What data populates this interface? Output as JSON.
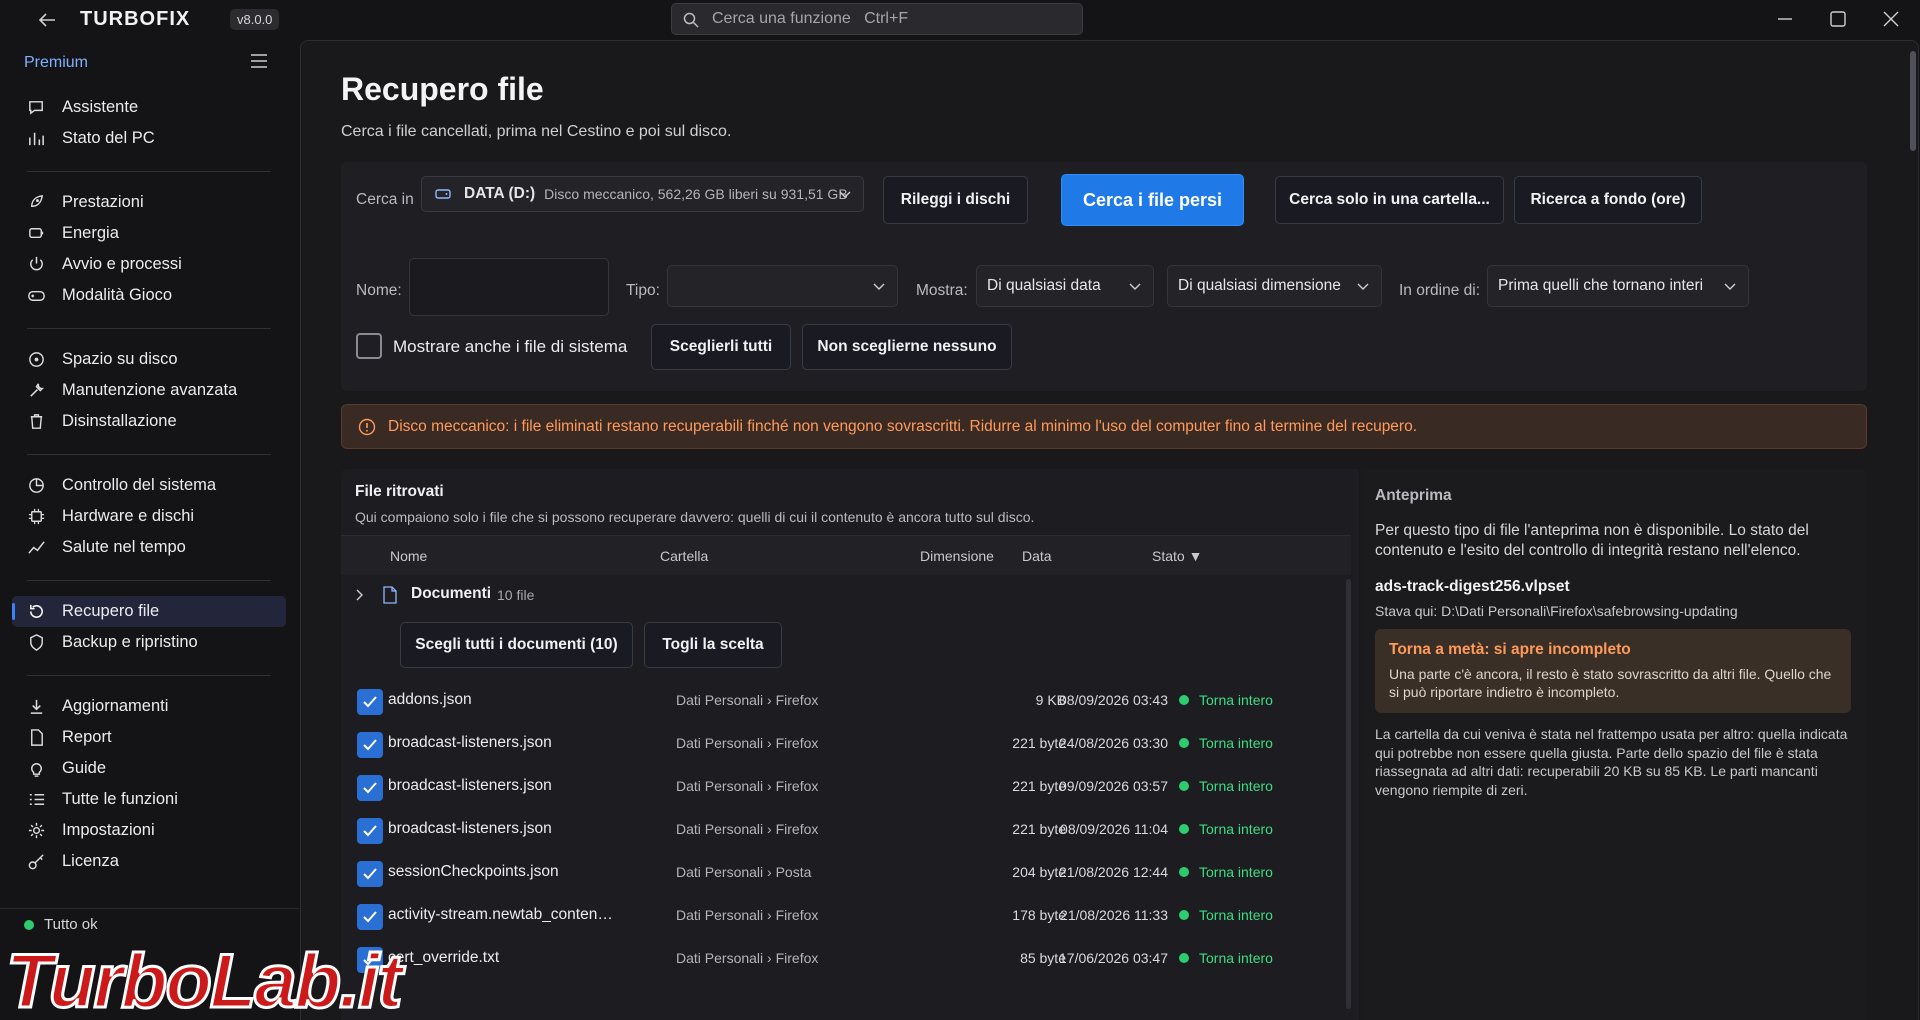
{
  "app": {
    "brand": "TURBOFIX",
    "version": "v8.0.0",
    "search_placeholder": "Cerca una funzione   Ctrl+F"
  },
  "sidebar": {
    "plan": "Premium",
    "groups": [
      [
        {
          "label": "Assistente",
          "icon": "chat-icon"
        },
        {
          "label": "Stato del PC",
          "icon": "chart-icon"
        }
      ],
      [
        {
          "label": "Prestazioni",
          "icon": "rocket-icon"
        },
        {
          "label": "Energia",
          "icon": "battery-icon"
        },
        {
          "label": "Avvio e processi",
          "icon": "power-icon"
        },
        {
          "label": "Modalità Gioco",
          "icon": "gamepad-icon"
        }
      ],
      [
        {
          "label": "Spazio su disco",
          "icon": "drive-icon"
        },
        {
          "label": "Manutenzione avanzata",
          "icon": "wrench-icon"
        },
        {
          "label": "Disinstallazione",
          "icon": "trash-icon"
        }
      ],
      [
        {
          "label": "Controllo del sistema",
          "icon": "pie-icon"
        },
        {
          "label": "Hardware e dischi",
          "icon": "cpu-icon"
        },
        {
          "label": "Salute nel tempo",
          "icon": "trend-icon"
        }
      ],
      [
        {
          "label": "Recupero file",
          "icon": "restore-icon",
          "active": true
        },
        {
          "label": "Backup e ripristino",
          "icon": "shield-icon"
        }
      ],
      [
        {
          "label": "Aggiornamenti",
          "icon": "download-icon"
        },
        {
          "label": "Report",
          "icon": "document-icon"
        },
        {
          "label": "Guide",
          "icon": "lightbulb-icon"
        },
        {
          "label": "Tutte le funzioni",
          "icon": "list-icon"
        },
        {
          "label": "Impostazioni",
          "icon": "gear-icon"
        },
        {
          "label": "Licenza",
          "icon": "key-icon"
        }
      ]
    ],
    "status": "Tutto ok"
  },
  "page": {
    "title": "Recupero file",
    "subtitle": "Cerca i file cancellati, prima nel Cestino e poi sul disco."
  },
  "search_panel": {
    "cerca_in_label": "Cerca in",
    "drive_name": "DATA (D:)",
    "drive_desc": "Disco meccanico, 562,26 GB liberi su 931,51 GB",
    "rescan_button": "Rileggi i dischi",
    "search_button": "Cerca i file persi",
    "folder_button": "Cerca solo in una cartella...",
    "deep_button": "Ricerca a fondo (ore)",
    "name_label": "Nome:",
    "name_value": "",
    "type_label": "Tipo:",
    "type_value": "",
    "show_label": "Mostra:",
    "date_filter": "Di qualsiasi data",
    "size_filter": "Di qualsiasi dimensione",
    "order_label": "In ordine di:",
    "order_value": "Prima quelli che tornano interi",
    "system_files_label": "Mostrare anche i file di sistema",
    "system_files_checked": false,
    "select_all_button": "Sceglierli tutti",
    "select_none_button": "Non sceglierne nessuno"
  },
  "warning": {
    "text": "Disco meccanico: i file eliminati restano recuperabili finché non vengono sovrascritti. Ridurre al minimo l'uso del computer fino al termine del recupero."
  },
  "results": {
    "title": "File ritrovati",
    "subtitle": "Qui compaiono solo i file che si possono recuperare davvero: quelli di cui il contenuto è ancora tutto sul disco.",
    "columns": {
      "name": "Nome",
      "folder": "Cartella",
      "size": "Dimensione",
      "date": "Data",
      "state": "Stato ▼"
    },
    "group": {
      "name": "Documenti",
      "count": "10 file"
    },
    "group_select_button": "Scegli tutti i documenti (10)",
    "group_clear_button": "Togli la scelta",
    "rows": [
      {
        "name": "addons.json",
        "folder": "Dati Personali › Firefox",
        "size": "9 KB",
        "date": "08/09/2026 03:43",
        "state": "Torna intero"
      },
      {
        "name": "broadcast-listeners.json",
        "folder": "Dati Personali › Firefox",
        "size": "221 byte",
        "date": "24/08/2026 03:30",
        "state": "Torna intero"
      },
      {
        "name": "broadcast-listeners.json",
        "folder": "Dati Personali › Firefox",
        "size": "221 byte",
        "date": "09/09/2026 03:57",
        "state": "Torna intero"
      },
      {
        "name": "broadcast-listeners.json",
        "folder": "Dati Personali › Firefox",
        "size": "221 byte",
        "date": "08/09/2026 11:04",
        "state": "Torna intero"
      },
      {
        "name": "sessionCheckpoints.json",
        "folder": "Dati Personali › Posta",
        "size": "204 byte",
        "date": "21/08/2026 12:44",
        "state": "Torna intero"
      },
      {
        "name": "activity-stream.newtab_content_event_...",
        "folder": "Dati Personali › Firefox",
        "size": "178 byte",
        "date": "21/08/2026 11:33",
        "state": "Torna intero"
      },
      {
        "name": "cert_override.txt",
        "folder": "Dati Personali › Firefox",
        "size": "85 byte",
        "date": "17/06/2026 03:47",
        "state": "Torna intero"
      }
    ]
  },
  "preview": {
    "title": "Anteprima",
    "note": "Per questo tipo di file l'anteprima non è disponibile. Lo stato del contenuto e l'esito del controllo di integrità restano nell'elenco.",
    "file_name": "ads-track-digest256.vlpset",
    "file_path": "Stava qui: D:\\Dati Personali\\Firefox\\safebrowsing-updating",
    "box_title": "Torna a metà: si apre incompleto",
    "box_body": "Una parte c'è ancora, il resto è stato sovrascritto da altri file. Quello che si può riportare indietro è incompleto.",
    "description": "La cartella da cui veniva è stata nel frattempo usata per altro: quella indicata qui potrebbe non essere quella giusta. Parte dello spazio del file è stata riassegnata ad altri dati: recuperabili 20 KB su 85 KB. Le parti mancanti vengono riempite di zeri."
  },
  "watermark": {
    "text": "TurboLab.it"
  },
  "colors": {
    "accent": "#1f7ae8",
    "ok": "#2ecc71",
    "warning": "#ff9a5a"
  }
}
